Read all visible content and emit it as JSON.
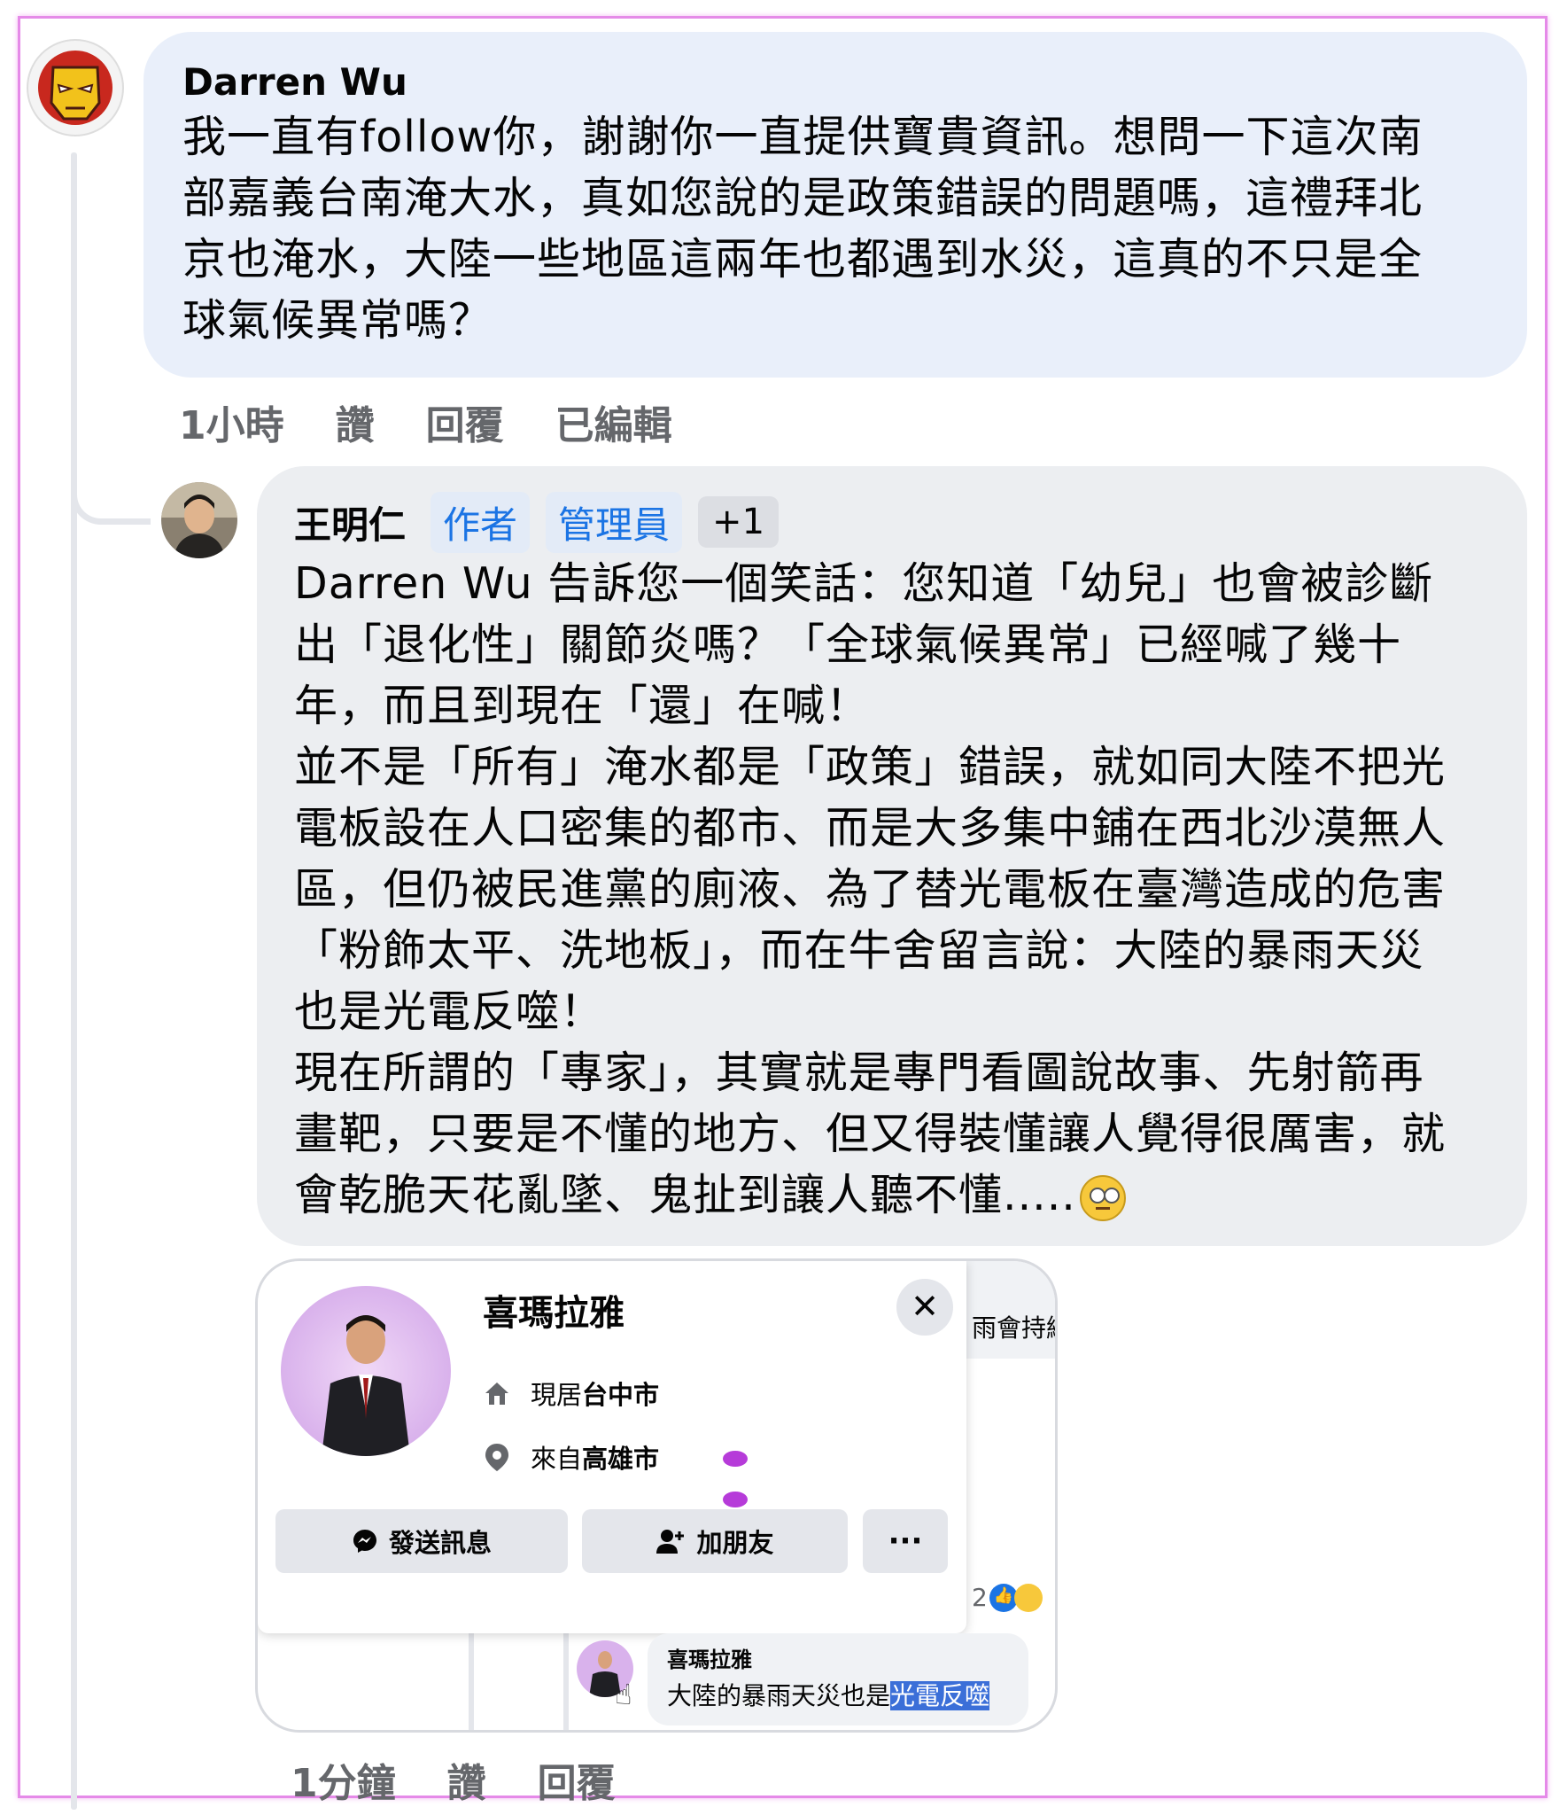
{
  "comments": [
    {
      "author": "Darren Wu",
      "text": "我一直有follow你，謝謝你一直提供寶貴資訊。想問一下這次南\n部嘉義台南淹大水，真如您說的是政策錯誤的問題嗎，這禮拜北\n京也淹水，大陸一些地區這兩年也都遇到水災，這真的不只是全\n球氣候異常嗎？",
      "time": "1小時",
      "like": "讚",
      "reply": "回覆",
      "edited": "已編輯"
    },
    {
      "author": "王明仁",
      "badges": [
        "作者",
        "管理員"
      ],
      "extra_badge": "+1",
      "text": "Darren Wu 告訴您一個笑話：您知道「幼兒」也會被診斷\n出「退化性」關節炎嗎？「全球氣候異常」已經喊了幾十\n年，而且到現在「還」在喊！\n並不是「所有」淹水都是「政策」錯誤，就如同大陸不把光\n電板設在人口密集的都市、而是大多集中鋪在西北沙漠無人\n區，但仍被民進黨的廁液、為了替光電板在臺灣造成的危害\n「粉飾太平、洗地板」，而在牛舍留言說：大陸的暴雨天災\n也是光電反噬！\n現在所謂的「專家」，其實就是專門看圖說故事、先射箭再\n畫靶，只要是不懂的地方、但又得裝懂讓人覺得很厲害，就\n會乾脆天花亂墜、鬼扯到讓人聽不懂.....",
      "emoji": "face-with-rolling-eyes",
      "time": "1分鐘",
      "like": "讚",
      "reply": "回覆"
    }
  ],
  "screenshot": {
    "profile_card": {
      "name": "喜瑪拉雅",
      "lives_prefix": "現居",
      "lives_city": "台中市",
      "from_prefix": "來自",
      "from_city": "高雄市",
      "send_message": "發送訊息",
      "add_friend": "加朋友",
      "more": "···",
      "close": "✕"
    },
    "background_fragment": "雨會持續",
    "reaction_count": "2",
    "reply": {
      "name": "喜瑪拉雅",
      "text_plain": "大陸的暴雨天災也是",
      "text_highlight": "光電反噬"
    }
  },
  "colors": {
    "bubble": "#e9effa",
    "badge_blue": "#1b74e4",
    "meta_gray": "#65676b",
    "frame_pink": "#e58ae8"
  }
}
